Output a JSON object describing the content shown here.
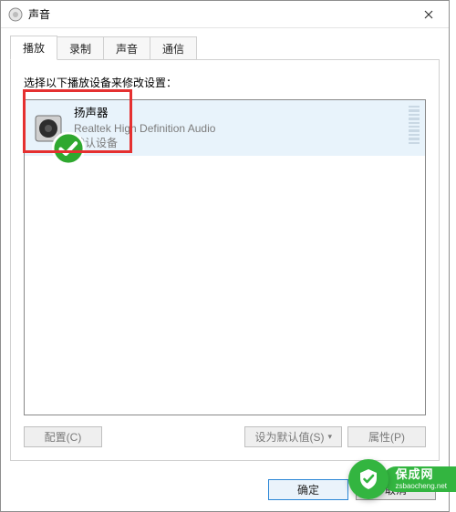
{
  "window": {
    "title": "声音"
  },
  "tabs": {
    "playback": "播放",
    "recording": "录制",
    "sounds": "声音",
    "comm": "通信"
  },
  "instruction": "选择以下播放设备来修改设置：",
  "device": {
    "name": "扬声器",
    "driver": "Realtek High Definition Audio",
    "status": "默认设备"
  },
  "buttons": {
    "configure": "配置(C)",
    "set_default": "设为默认值(S)",
    "properties": "属性(P)",
    "ok": "确定",
    "cancel": "取消"
  },
  "watermark": {
    "zh": "保成网",
    "en": "zsbaocheng.net"
  }
}
